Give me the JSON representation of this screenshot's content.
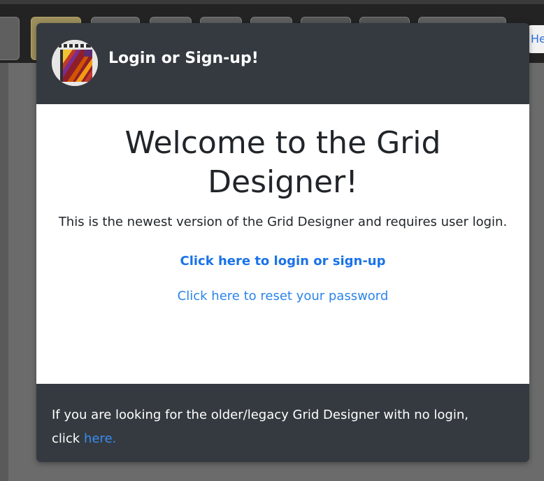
{
  "toolbar": {
    "edge_label": "He"
  },
  "modal": {
    "title": "Login or Sign-up!",
    "logo_icon": "woven-grid-logo-icon",
    "welcome_heading": "Welcome to the Grid Designer!",
    "description": "This is the newest version of the Grid Designer and requires user login.",
    "login_link_label": "Click here to login or sign-up",
    "reset_link_label": "Click here to reset your password",
    "footer_text": "If you are looking for the older/legacy Grid Designer with no login, click",
    "footer_link_label": "here."
  },
  "colors": {
    "header_bg": "#343a40",
    "body_bg": "#ffffff",
    "link": "#1a73e8",
    "backdrop": "#6b6b6b"
  }
}
